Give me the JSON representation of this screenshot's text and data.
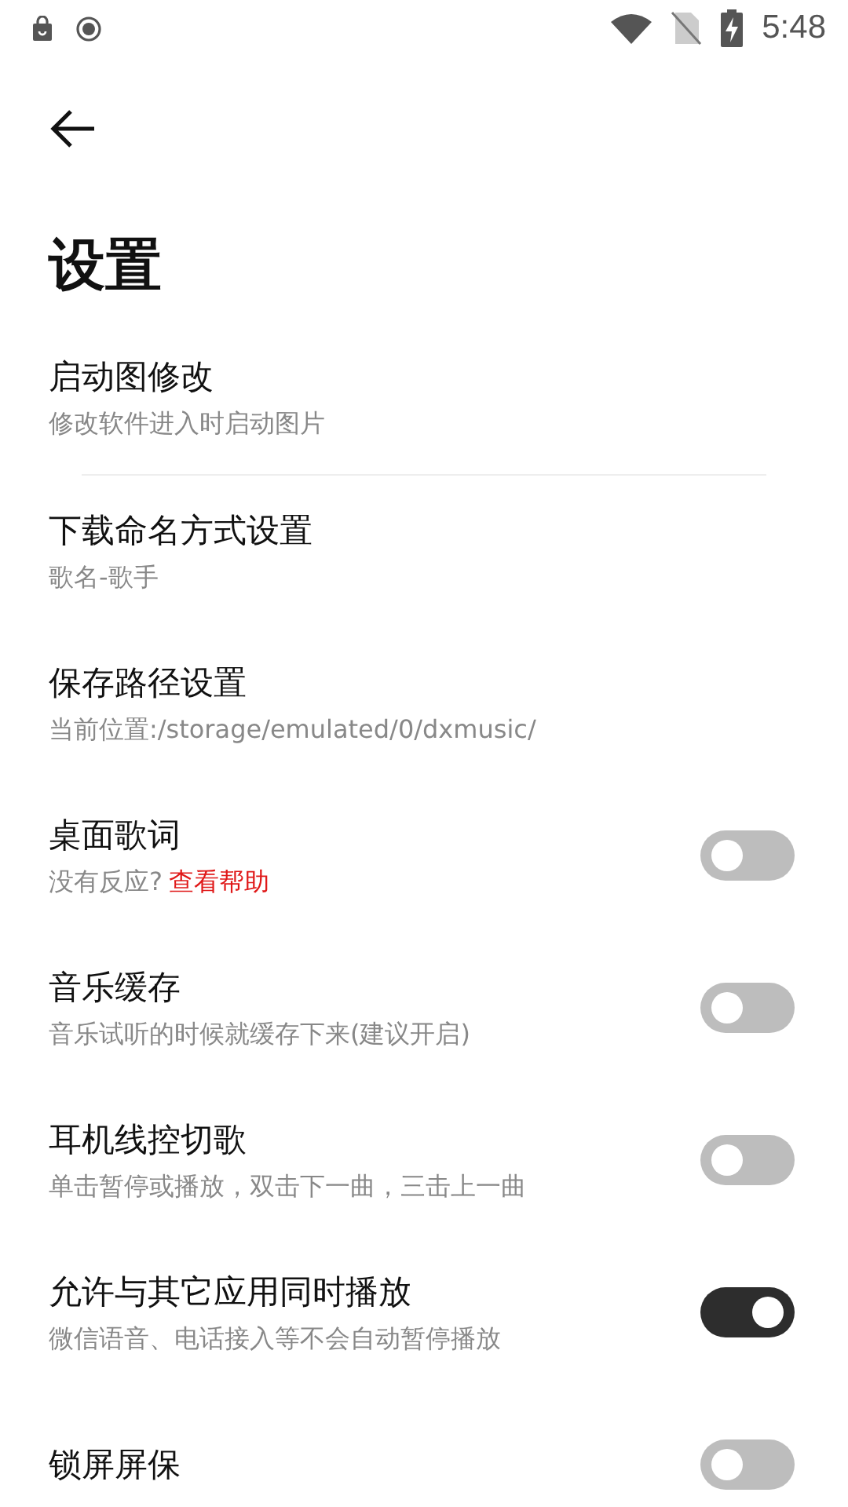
{
  "status_bar": {
    "time": "5:48"
  },
  "title": "设置",
  "settings": [
    {
      "kind": "plain",
      "title": "启动图修改",
      "subtitle": "修改软件进入时启动图片",
      "divider": true
    },
    {
      "kind": "plain",
      "title": "下载命名方式设置",
      "subtitle": "歌名-歌手"
    },
    {
      "kind": "plain",
      "title": "保存路径设置",
      "subtitle": "当前位置:/storage/emulated/0/dxmusic/"
    },
    {
      "kind": "toggle",
      "title": "桌面歌词",
      "subtitle": "没有反应?",
      "link": "查看帮助",
      "on": false
    },
    {
      "kind": "toggle",
      "title": "音乐缓存",
      "subtitle": "音乐试听的时候就缓存下来(建议开启)",
      "on": false
    },
    {
      "kind": "toggle",
      "title": "耳机线控切歌",
      "subtitle": "单击暂停或播放，双击下一曲，三击上一曲",
      "on": false
    },
    {
      "kind": "toggle",
      "title": "允许与其它应用同时播放",
      "subtitle": "微信语音、电话接入等不会自动暂停播放",
      "on": true
    },
    {
      "kind": "toggle",
      "title": "锁屏屏保",
      "on": false
    }
  ]
}
